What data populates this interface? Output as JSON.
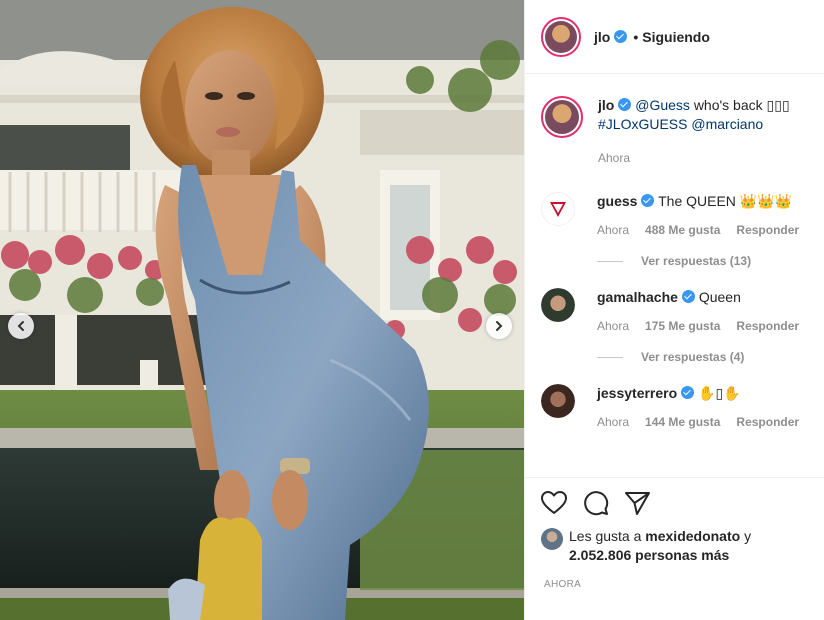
{
  "post_author": {
    "username": "jlo",
    "follow_status": "Siguiendo",
    "separator": "•"
  },
  "caption": {
    "username": "jlo",
    "mention_guess": "@Guess",
    "text": "who's back",
    "emoji": "▯▯▯",
    "hashtag": "#JLOxGUESS",
    "mention_marciano": "@marciano",
    "time": "Ahora"
  },
  "comments": [
    {
      "username": "guess",
      "text": "The QUEEN",
      "emoji": "👑👑👑",
      "time": "Ahora",
      "likes": "488 Me gusta",
      "reply": "Responder",
      "view_replies": "Ver respuestas (13)",
      "avatar_color": "#ffffff"
    },
    {
      "username": "gamalhache",
      "text": "Queen",
      "emoji": "",
      "time": "Ahora",
      "likes": "175 Me gusta",
      "reply": "Responder",
      "view_replies": "Ver respuestas (4)",
      "avatar_color": "#3d5a4a"
    },
    {
      "username": "jessyterrero",
      "text": "",
      "emoji": "✋▯✋",
      "time": "Ahora",
      "likes": "144 Me gusta",
      "reply": "Responder",
      "view_replies": "",
      "avatar_color": "#5a3b2e"
    }
  ],
  "likes": {
    "prefix": "Les gusta a",
    "user": "mexidedonato",
    "conj": "y",
    "count": "2.052.806 personas más"
  },
  "timestamp": "AHORA",
  "icons": {
    "like": "heart-icon",
    "comment": "comment-icon",
    "share": "share-icon",
    "prev": "chevron-left-icon",
    "next": "chevron-right-icon",
    "verified": "verified-badge-icon"
  },
  "colors": {
    "link": "#00376b",
    "verified": "#3897f0",
    "muted": "#8e8e8e",
    "story_ring": "#e1306c"
  }
}
